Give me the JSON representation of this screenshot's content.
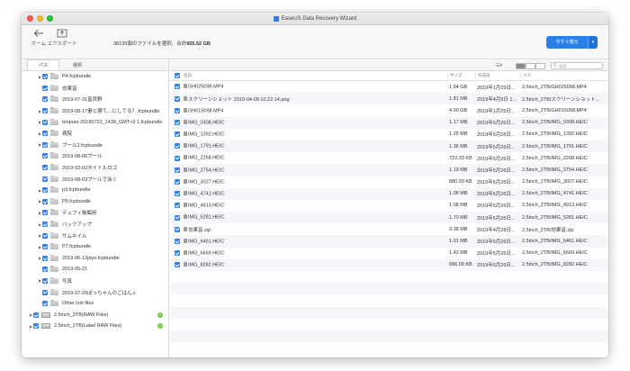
{
  "window": {
    "title": "EaseUS Data Recovery Wizard"
  },
  "toolbar": {
    "home_label": "ホーム",
    "export_label": "エクスポート",
    "summary_prefix": "38135個のファイルを選択、合計",
    "summary_total": "905.52 GB",
    "recover_label": "今すぐ復元",
    "recover_dropdown": "▾"
  },
  "sidebar": {
    "tabs": [
      {
        "label": "パス"
      },
      {
        "label": "種類"
      }
    ],
    "items": [
      {
        "label": "P4.fcpbundle",
        "expand": "▶",
        "type": "folder",
        "indent": 18
      },
      {
        "label": "効果音",
        "expand": "",
        "type": "folder",
        "indent": 18
      },
      {
        "label": "2019-07-31富良野",
        "expand": "",
        "type": "folder",
        "indent": 18
      },
      {
        "label": "2019-08-17妻と寝て…にしてる？.fcpbundle",
        "expand": "▶",
        "type": "folder",
        "indent": 18
      },
      {
        "label": "tenpure 20190722_1439_GMT+9 1.fcpbundle",
        "expand": "▶",
        "type": "folder",
        "indent": 18
      },
      {
        "label": "病院",
        "expand": "▶",
        "type": "folder",
        "indent": 18
      },
      {
        "label": "プール2.fcpbundle",
        "expand": "▶",
        "type": "folder",
        "indent": 18
      },
      {
        "label": "2019-08-06プール",
        "expand": "",
        "type": "folder",
        "indent": 18
      },
      {
        "label": "2019-02-03タイトルロゴ",
        "expand": "",
        "type": "folder",
        "indent": 18
      },
      {
        "label": "2019-08-03プールで泳ぐ",
        "expand": "",
        "type": "folder",
        "indent": 18
      },
      {
        "label": "p3.fcpbundle",
        "expand": "▶",
        "type": "folder",
        "indent": 18
      },
      {
        "label": "P5.fcpbundle",
        "expand": "▶",
        "type": "folder",
        "indent": 18
      },
      {
        "label": "デュフィ後編用",
        "expand": "▶",
        "type": "folder",
        "indent": 18
      },
      {
        "label": "バックアップ",
        "expand": "▶",
        "type": "folder",
        "indent": 18
      },
      {
        "label": "サムネイル",
        "expand": "▶",
        "type": "folder",
        "indent": 18
      },
      {
        "label": "P7.fcpbundle",
        "expand": "▶",
        "type": "folder",
        "indent": 18
      },
      {
        "label": "2019-06-12piyo.fcpbundle",
        "expand": "▶",
        "type": "folder",
        "indent": 18
      },
      {
        "label": "2019-05-21",
        "expand": "",
        "type": "folder",
        "indent": 18
      },
      {
        "label": "写真",
        "expand": "▶",
        "type": "folder",
        "indent": 18
      },
      {
        "label": "2019-07-20ぽっちゃんのごはん♬",
        "expand": "",
        "type": "folder",
        "indent": 18
      },
      {
        "label": "Other lost files",
        "expand": "",
        "type": "folder",
        "indent": 18
      },
      {
        "label": "2.5inch_2TB(RAW Files)",
        "expand": "▶",
        "type": "drive",
        "indent": 8,
        "badge": "✓"
      },
      {
        "label": "2.5inch_2TB(Label RAW Files)",
        "expand": "▶",
        "type": "drive",
        "indent": 8,
        "badge": "✓"
      }
    ]
  },
  "viewbar": {
    "filter_icon": "filter-icon",
    "search_placeholder": "検索"
  },
  "table": {
    "columns": {
      "name": "名前",
      "size": "サイズ",
      "date": "作成日",
      "path": "パス"
    },
    "rows": [
      {
        "name": "GH025098.MP4",
        "size": "1.94 GB",
        "date": "2019年1月25日...",
        "path": "2.5inch_2TB/GH025098.MP4"
      },
      {
        "name": "スクリーンショット 2019-04-09 10.22.14.png",
        "size": "1.81 MB",
        "date": "2019年4月9日 1...",
        "path": "2.5inch_2TB/スクリーンショット..."
      },
      {
        "name": "GH015098.MP4",
        "size": "4.00 GB",
        "date": "2019年1月25日...",
        "path": "2.5inch_2TB/GH015098.MP4"
      },
      {
        "name": "IMG_0308.HEIC",
        "size": "1.17 MB",
        "date": "2019年5月26日...",
        "path": "2.5inch_2TB/IMG_0308.HEIC"
      },
      {
        "name": "IMG_1392.HEIC",
        "size": "1.25 MB",
        "date": "2019年5月26日...",
        "path": "2.5inch_2TB/IMG_1392.HEIC"
      },
      {
        "name": "IMG_1791.HEIC",
        "size": "1.36 MB",
        "date": "2019年5月26日...",
        "path": "2.5inch_2TB/IMG_1791.HEIC"
      },
      {
        "name": "IMG_2268.HEIC",
        "size": "722.33 KB",
        "date": "2019年5月26日...",
        "path": "2.5inch_2TB/IMG_2268.HEIC"
      },
      {
        "name": "IMG_2754.HEIC",
        "size": "1.19 MB",
        "date": "2019年5月26日...",
        "path": "2.5inch_2TB/IMG_2754.HEIC"
      },
      {
        "name": "IMG_3027.HEIC",
        "size": "880.93 KB",
        "date": "2019年5月26日...",
        "path": "2.5inch_2TB/IMG_3027.HEIC"
      },
      {
        "name": "IMG_4741.HEIC",
        "size": "1.06 MB",
        "date": "2019年5月26日...",
        "path": "2.5inch_2TB/IMG_4741.HEIC"
      },
      {
        "name": "IMG_4913.HEIC",
        "size": "1.08 MB",
        "date": "2019年5月26日...",
        "path": "2.5inch_2TB/IMG_4913.HEIC"
      },
      {
        "name": "IMG_5281.HEIC",
        "size": "1.70 MB",
        "date": "2019年5月26日...",
        "path": "2.5inch_2TB/IMG_5281.HEIC"
      },
      {
        "name": "効果音.zip",
        "size": "3.38 MB",
        "date": "2019年4月28日...",
        "path": "2.5inch_2TB/効果音.zip"
      },
      {
        "name": "IMG_6461.HEIC",
        "size": "1.01 MB",
        "date": "2019年5月26日...",
        "path": "2.5inch_2TB/IMG_6461.HEIC"
      },
      {
        "name": "IMG_6669.HEIC",
        "size": "1.43 MB",
        "date": "2019年5月26日...",
        "path": "2.5inch_2TB/IMG_6669.HEIC"
      },
      {
        "name": "IMG_8282.HEIC",
        "size": "686.09 KB",
        "date": "2019年5月26日...",
        "path": "2.5inch_2TB/IMG_8282.HEIC"
      }
    ]
  },
  "colors": {
    "accent": "#2b7fe8",
    "checkbox": "#2f80ed",
    "ok_badge": "#7ac943"
  }
}
